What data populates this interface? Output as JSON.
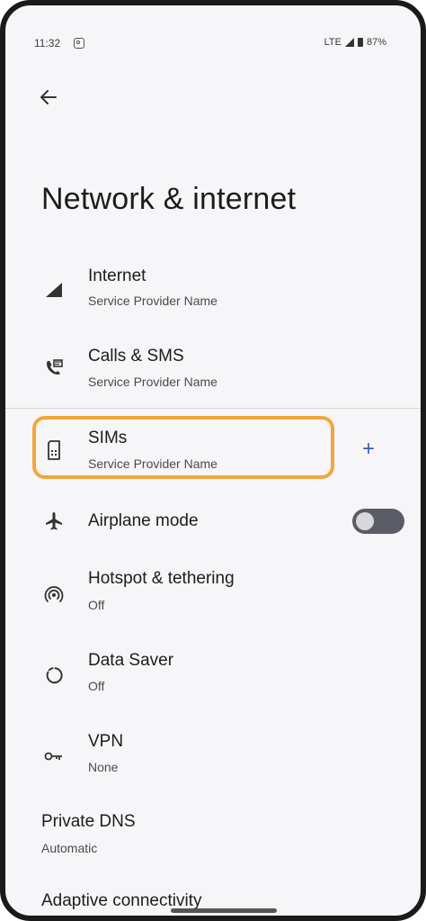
{
  "status_bar": {
    "time": "11:32",
    "network": "LTE",
    "battery": "87%"
  },
  "header": {
    "title": "Network & internet"
  },
  "items": [
    {
      "title": "Internet",
      "subtitle": "Service Provider Name",
      "icon": "signal-icon"
    },
    {
      "title": "Calls & SMS",
      "subtitle": "Service Provider Name",
      "icon": "phone-icon"
    },
    {
      "title": "SIMs",
      "subtitle": "Service Provider Name",
      "icon": "sim-icon"
    },
    {
      "title": "Airplane mode",
      "subtitle": "",
      "icon": "airplane-icon",
      "toggle_on": false
    },
    {
      "title": "Hotspot & tethering",
      "subtitle": "Off",
      "icon": "hotspot-icon"
    },
    {
      "title": "Data Saver",
      "subtitle": "Off",
      "icon": "data-saver-icon"
    },
    {
      "title": "VPN",
      "subtitle": "None",
      "icon": "key-icon"
    }
  ],
  "private_dns": {
    "title": "Private DNS",
    "subtitle": "Automatic"
  },
  "adaptive": {
    "title": "Adaptive connectivity"
  },
  "colors": {
    "highlight": "#f3a53b",
    "accent": "#3d5bb5",
    "toggle_off": "#5a5d66"
  }
}
